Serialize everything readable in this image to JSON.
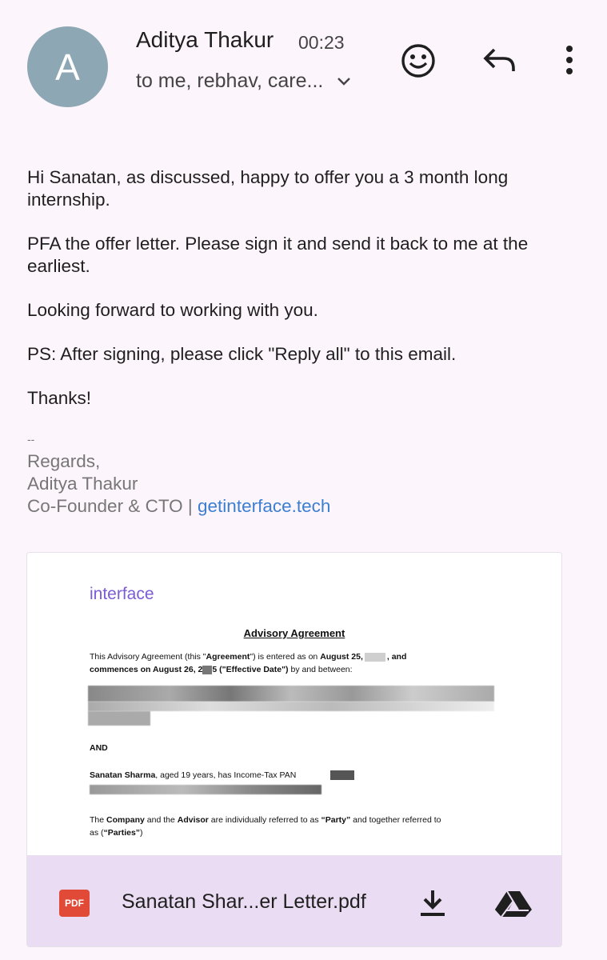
{
  "header": {
    "avatar_letter": "A",
    "sender_name": "Aditya Thakur",
    "time": "00:23",
    "recipients": "to me, rebhav, care..."
  },
  "body": {
    "paragraphs": [
      "Hi Sanatan, as discussed, happy to offer you a 3 month long internship.",
      "PFA the offer letter. Please sign it and send it back to me at the earliest.",
      "Looking forward to working with you.",
      "PS: After signing, please click \"Reply all\" to this email.",
      "Thanks!"
    ]
  },
  "signature": {
    "separator": "--",
    "regards": "Regards,",
    "name": "Aditya Thakur",
    "role": "Co-Founder & CTO |",
    "link": "getinterface.tech"
  },
  "attachment": {
    "preview": {
      "logo": "interface",
      "title": "Advisory Agreement",
      "p1_a": "This Advisory Agreement (this \"",
      "p1_b": "Agreement",
      "p1_c": "\") is entered as on ",
      "p1_d": "August 25,",
      "p1_e": ", and",
      "p1_f": "commences on August 26, 2",
      "p1_g": "5 (\"Effective Date\")",
      "p1_h": " by and between:",
      "and": "AND",
      "p2_a": "Sanatan Sharma",
      "p2_b": ", aged 19 years, has Income-Tax PAN ",
      "p3_a": "The ",
      "p3_b": "Company",
      "p3_c": " and the ",
      "p3_d": "Advisor",
      "p3_e": " are individually referred to as ",
      "p3_f": "“Party”",
      "p3_g": " and together referred to",
      "p3_h": "as (",
      "p3_i": "“Parties”",
      "p3_j": ")"
    },
    "file_type": "PDF",
    "file_name": "Sanatan Shar...er Letter.pdf"
  },
  "icons": {
    "emoji": "emoji-icon",
    "reply": "reply-icon",
    "more": "more-vert-icon",
    "download": "download-icon",
    "drive": "google-drive-icon"
  },
  "colors": {
    "background": "#fcf5fc",
    "avatar": "#8ea7b4",
    "link": "#3c7fd0",
    "attachment_bar": "#eadcf2",
    "pdf_badge": "#e04a36",
    "logo": "#7b5bd6"
  }
}
